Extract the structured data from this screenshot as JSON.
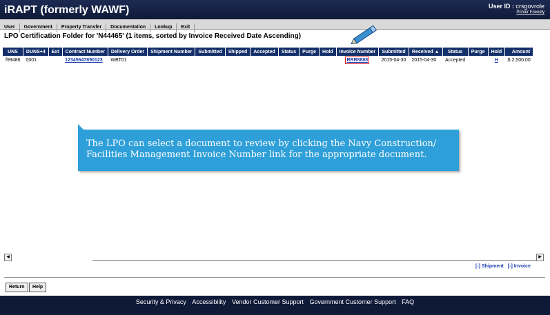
{
  "header": {
    "app_title": "iRAPT (formerly WAWF)",
    "userid_label": "User ID :",
    "userid_value": "crsgovrole",
    "printer_friendly": "Printer Friendly"
  },
  "menu": [
    "User",
    "Government",
    "Property Transfer",
    "Documentation",
    "Lookup",
    "Exit"
  ],
  "page_title": "LPO Certification Folder for 'N44465' (1 items, sorted by Invoice Received Date Ascending)",
  "table": {
    "headers": [
      "UNS",
      "DUNS+4",
      "Ext",
      "Contract Number",
      "Delivery Order",
      "Shipment Number",
      "Submitted",
      "Shipped",
      "Accepted",
      "Status",
      "Purge",
      "Hold",
      "Invoice Number",
      "Submitted",
      "Received ▲",
      "Status",
      "Purge",
      "Hold",
      "Amount"
    ],
    "row": {
      "uns": "f99486",
      "duns4": "0001",
      "ext": "",
      "contract": "12345647890123",
      "delivery_order": "WBT01",
      "shipment_number": "",
      "submitted1": "",
      "shipped": "",
      "accepted": "",
      "status1": "",
      "purge1": "",
      "hold1": "",
      "invoice": "RRR8888",
      "submitted2": "2015-04-30",
      "received": "2015-04-30",
      "status2": "Accepted",
      "purge2": "",
      "hold2": "H",
      "amount": "$ 2,500.00"
    }
  },
  "callout": {
    "line1": "The LPO can select a document to review by clicking the Navy Construction/",
    "line2": "Facilities Management Invoice Number link for the appropriate document."
  },
  "toggles": {
    "shipment": "[-] Shipment",
    "invoice": "[-] Invoice"
  },
  "buttons": {
    "return": "Return",
    "help": "Help"
  },
  "footer": [
    "Security & Privacy",
    "Accessibility",
    "Vendor Customer Support",
    "Government Customer Support",
    "FAQ"
  ],
  "colors": {
    "header_bg": "#0f1a38",
    "table_header": "#14306a",
    "callout": "#2e9fd8",
    "link": "#1b3cb0",
    "highlight": "#d21f2b"
  }
}
